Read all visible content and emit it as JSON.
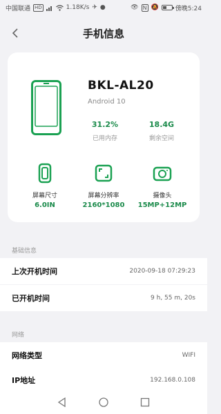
{
  "status": {
    "carrier": "中国联通",
    "hd": "HD",
    "net_speed": "1.18K/s",
    "time": "傍晚5:24"
  },
  "header": {
    "title": "手机信息"
  },
  "device": {
    "model": "BKL-AL20",
    "os": "Android 10",
    "memory_used_value": "31.2%",
    "memory_used_label": "已用内存",
    "storage_free_value": "18.4G",
    "storage_free_label": "剩余空间"
  },
  "specs": [
    {
      "label": "屏幕尺寸",
      "value": "6.0IN",
      "icon": "screen-size-icon"
    },
    {
      "label": "屏幕分辨率",
      "value": "2160*1080",
      "icon": "resolution-icon"
    },
    {
      "label": "摄像头",
      "value": "15MP+12MP",
      "icon": "camera-icon"
    }
  ],
  "sections": {
    "basic": {
      "title": "基础信息",
      "rows": [
        {
          "label": "上次开机时间",
          "value": "2020-09-18 07:29:23"
        },
        {
          "label": "已开机时间",
          "value": "9 h, 55 m, 20s"
        }
      ]
    },
    "network": {
      "title": "网络",
      "rows": [
        {
          "label": "网络类型",
          "value": "WIFI"
        },
        {
          "label": "IP地址",
          "value": "192.168.0.108"
        }
      ]
    }
  },
  "colors": {
    "accent": "#1a8a4a",
    "background": "#f2f2f5"
  }
}
